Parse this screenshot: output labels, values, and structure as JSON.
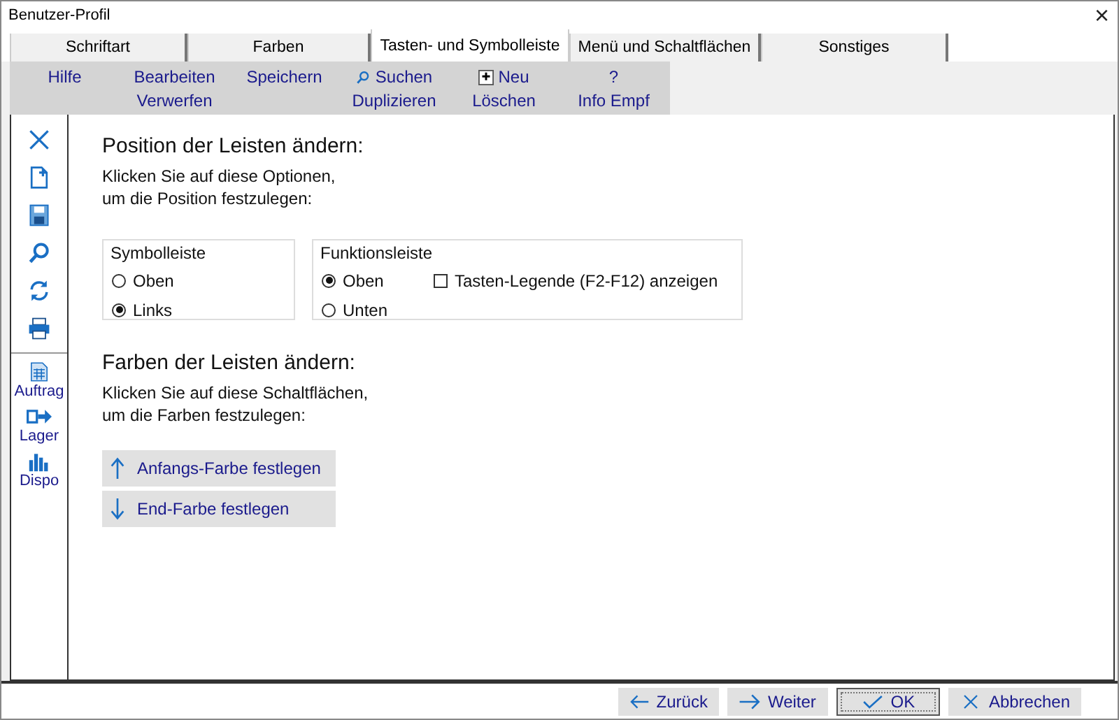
{
  "window": {
    "title": "Benutzer-Profil",
    "close": "×"
  },
  "tabs": [
    {
      "label": "Schriftart",
      "selected": false
    },
    {
      "label": "Farben",
      "selected": false
    },
    {
      "label": "Tasten- und Symbolleiste",
      "selected": true
    },
    {
      "label": "Menü und Schaltflächen",
      "selected": false
    },
    {
      "label": "Sonstiges",
      "selected": false
    }
  ],
  "function_bar": [
    [
      {
        "label": "Hilfe"
      }
    ],
    [
      {
        "label": "Bearbeiten"
      },
      {
        "label": "Verwerfen"
      }
    ],
    [
      {
        "label": "Speichern"
      }
    ],
    [
      {
        "label": "Suchen",
        "kind": "search"
      },
      {
        "label": "Duplizieren"
      }
    ],
    [
      {
        "label": "Neu",
        "kind": "new"
      },
      {
        "label": "Löschen"
      }
    ],
    [
      {
        "label": "?"
      },
      {
        "label": "Info Empf"
      }
    ]
  ],
  "sidebar": [
    {
      "kind": "close"
    },
    {
      "kind": "new"
    },
    {
      "kind": "save"
    },
    {
      "kind": "search"
    },
    {
      "kind": "refresh"
    },
    {
      "kind": "print"
    },
    {
      "kind": "separator"
    },
    {
      "kind": "table",
      "label": "Auftrag"
    },
    {
      "kind": "transfer",
      "label": "Lager"
    },
    {
      "kind": "chart",
      "label": "Dispo"
    }
  ],
  "position": {
    "heading": "Position der Leisten ändern:",
    "text": [
      "Klicken Sie auf diese Optionen,",
      "um die Position festzulegen:"
    ],
    "groups": [
      {
        "title": "Symbolleiste",
        "options": [
          {
            "kind": "radio",
            "label": "Oben",
            "selected": false
          },
          {
            "kind": "radio",
            "label": "Links",
            "selected": true
          }
        ]
      },
      {
        "title": "Funktionsleiste",
        "options": [
          {
            "kind": "radio",
            "label": "Oben",
            "selected": true
          },
          {
            "kind": "checkbox",
            "label": "Tasten-Legende (F2-F12) anzeigen",
            "checked": false
          },
          {
            "kind": "radio",
            "label": "Unten",
            "selected": false
          }
        ]
      }
    ]
  },
  "colors": {
    "heading": "Farben der Leisten ändern:",
    "text": [
      "Klicken Sie auf diese Schaltflächen,",
      "um die Farben festzulegen:"
    ],
    "buttons": [
      {
        "label": "Anfangs-Farbe festlegen",
        "kind": "up"
      },
      {
        "label": "End-Farbe festlegen",
        "kind": "down"
      }
    ]
  },
  "footer": [
    {
      "label": "Zurück",
      "kind": "back",
      "default": false
    },
    {
      "label": "Weiter",
      "kind": "next",
      "default": false
    },
    {
      "label": "OK",
      "kind": "ok",
      "default": true
    },
    {
      "label": "Abbrechen",
      "kind": "cancel",
      "default": false
    }
  ]
}
